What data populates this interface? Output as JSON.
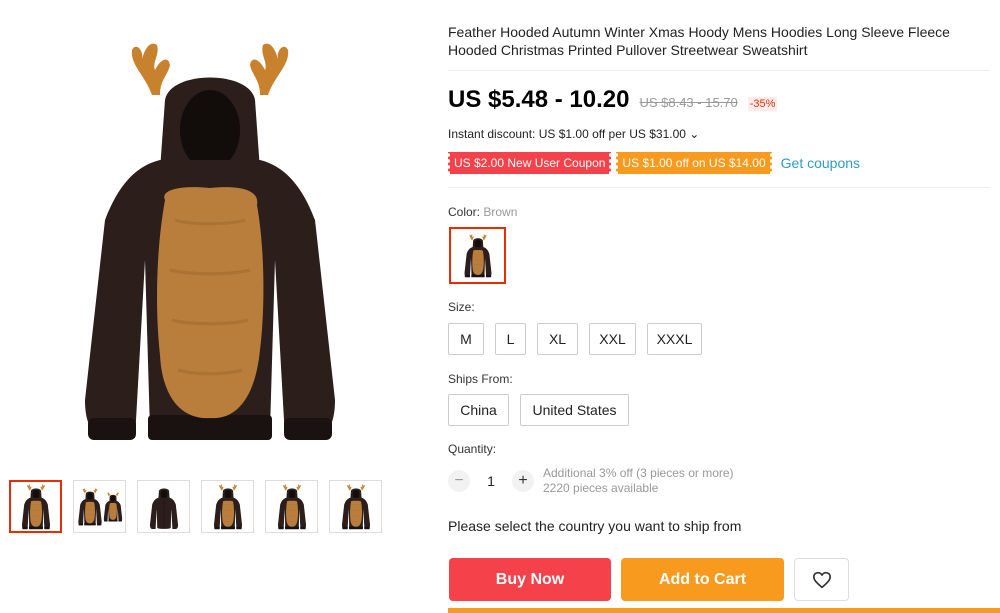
{
  "product": {
    "title": "Feather Hooded Autumn Winter Xmas Hoody Mens Hoodies Long Sleeve Fleece Hooded Christmas Printed Pullover Streetwear Sweatshirt",
    "price": "US $5.48 - 10.20",
    "old_price": "US $8.43 - 15.70",
    "discount_badge": "-35%",
    "instant_discount": "Instant discount: US $1.00 off per US $31.00 ⌄"
  },
  "coupons": {
    "items": [
      {
        "label": "US $2.00 New User Coupon",
        "color": "#f5424a"
      },
      {
        "label": "US $1.00 off on US $14.00",
        "color": "#f79a1e"
      }
    ],
    "get_link": "Get coupons"
  },
  "color": {
    "label": "Color:",
    "selected": "Brown"
  },
  "size": {
    "label": "Size:",
    "options": [
      "M",
      "L",
      "XL",
      "XXL",
      "XXXL"
    ]
  },
  "ships_from": {
    "label": "Ships From:",
    "options": [
      "China",
      "United States"
    ]
  },
  "quantity": {
    "label": "Quantity:",
    "minus": "−",
    "value": "1",
    "plus": "+",
    "info_line1": "Additional 3% off (3 pieces or more)",
    "info_line2": "2220 pieces available"
  },
  "ship_message": "Please select the country you want to ship from",
  "actions": {
    "buy_now": "Buy Now",
    "add_to_cart": "Add to Cart",
    "wishlist_icon": "heart-icon"
  },
  "theme": {
    "accent_red": "#f5424a",
    "accent_orange": "#f79a1e",
    "link_blue": "#2e9cc3"
  }
}
